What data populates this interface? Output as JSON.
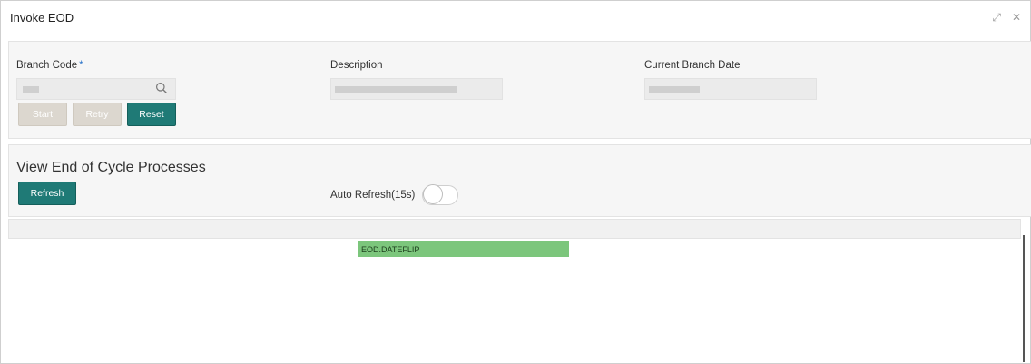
{
  "window": {
    "title": "Invoke EOD",
    "controls": [
      "maximize-icon",
      "close-icon"
    ],
    "maximize_glyph": "⤢",
    "close_glyph": "✕"
  },
  "fields": {
    "branch_code": {
      "label": "Branch Code",
      "required_mark": "*"
    },
    "description": {
      "label": "Description"
    },
    "current_branch_date": {
      "label": "Current Branch Date"
    }
  },
  "buttons": {
    "start": "Start",
    "retry": "Retry",
    "reset": "Reset",
    "refresh": "Refresh"
  },
  "processes": {
    "heading": "View End of Cycle Processes",
    "auto_refresh_label": "Auto Refresh(15s)",
    "auto_refresh_enabled": false
  },
  "grid": {
    "rows": [
      {
        "process": "EOD.DATEFLIP",
        "status_color": "#7cc67c"
      }
    ]
  },
  "colors": {
    "primary": "#1f7a76",
    "disabled": "#dcd7cf",
    "success": "#7cc67c"
  }
}
